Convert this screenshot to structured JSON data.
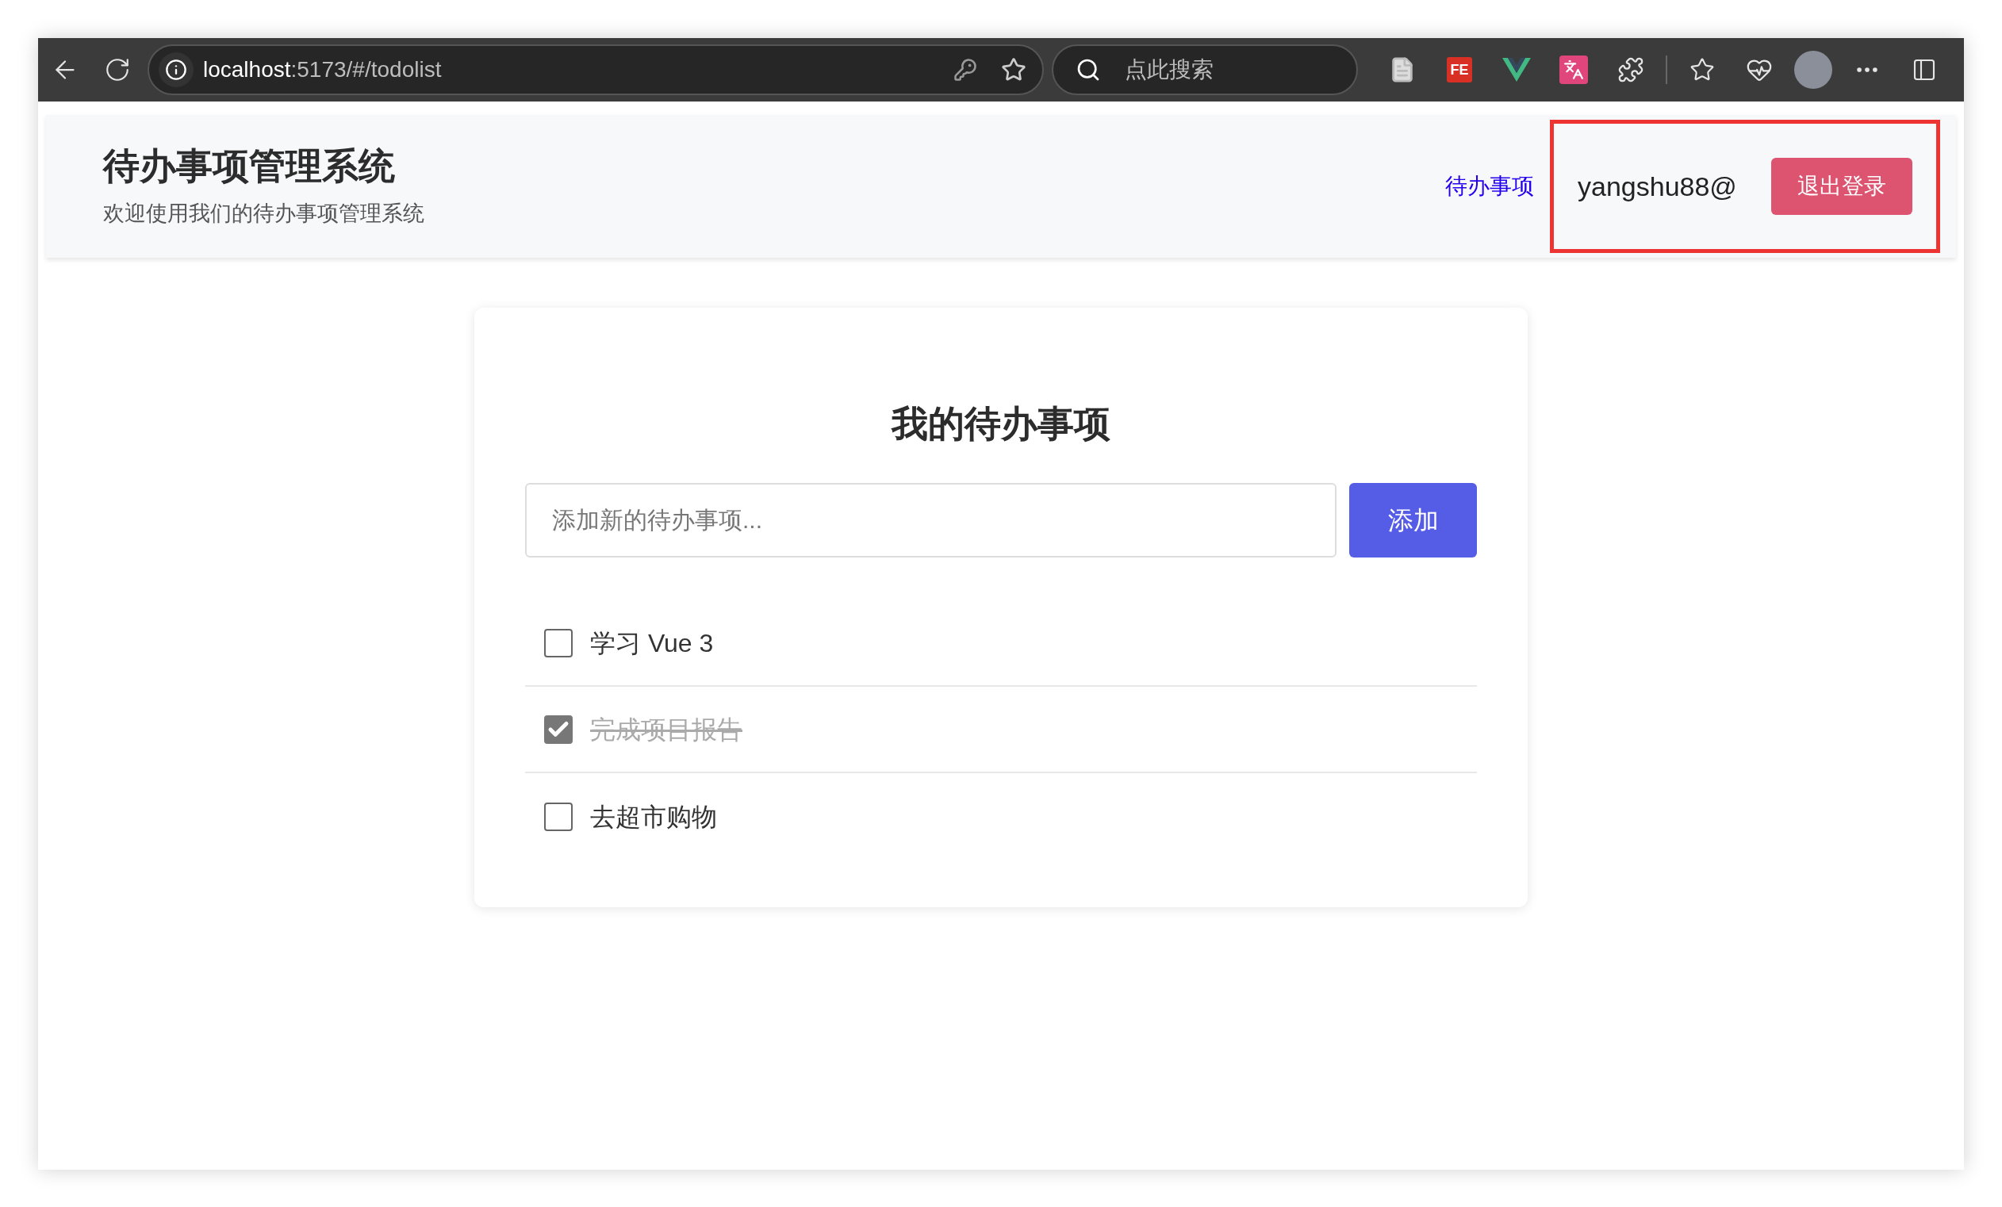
{
  "browser": {
    "url": {
      "host": "localhost",
      "path": ":5173/#/todolist"
    },
    "search": {
      "placeholder": "点此搜索"
    },
    "extension_label": "FE"
  },
  "header": {
    "title": "待办事项管理系统",
    "subtitle": "欢迎使用我们的待办事项管理系统",
    "nav_link": "待办事项",
    "username": "yangshu88@",
    "logout": "退出登录"
  },
  "todo": {
    "title": "我的待办事项",
    "input": {
      "placeholder": "添加新的待办事项..."
    },
    "add_button": "添加",
    "items": [
      {
        "text": "学习 Vue 3",
        "checked": false
      },
      {
        "text": "完成项目报告",
        "checked": true
      },
      {
        "text": "去超市购物",
        "checked": false
      }
    ]
  }
}
